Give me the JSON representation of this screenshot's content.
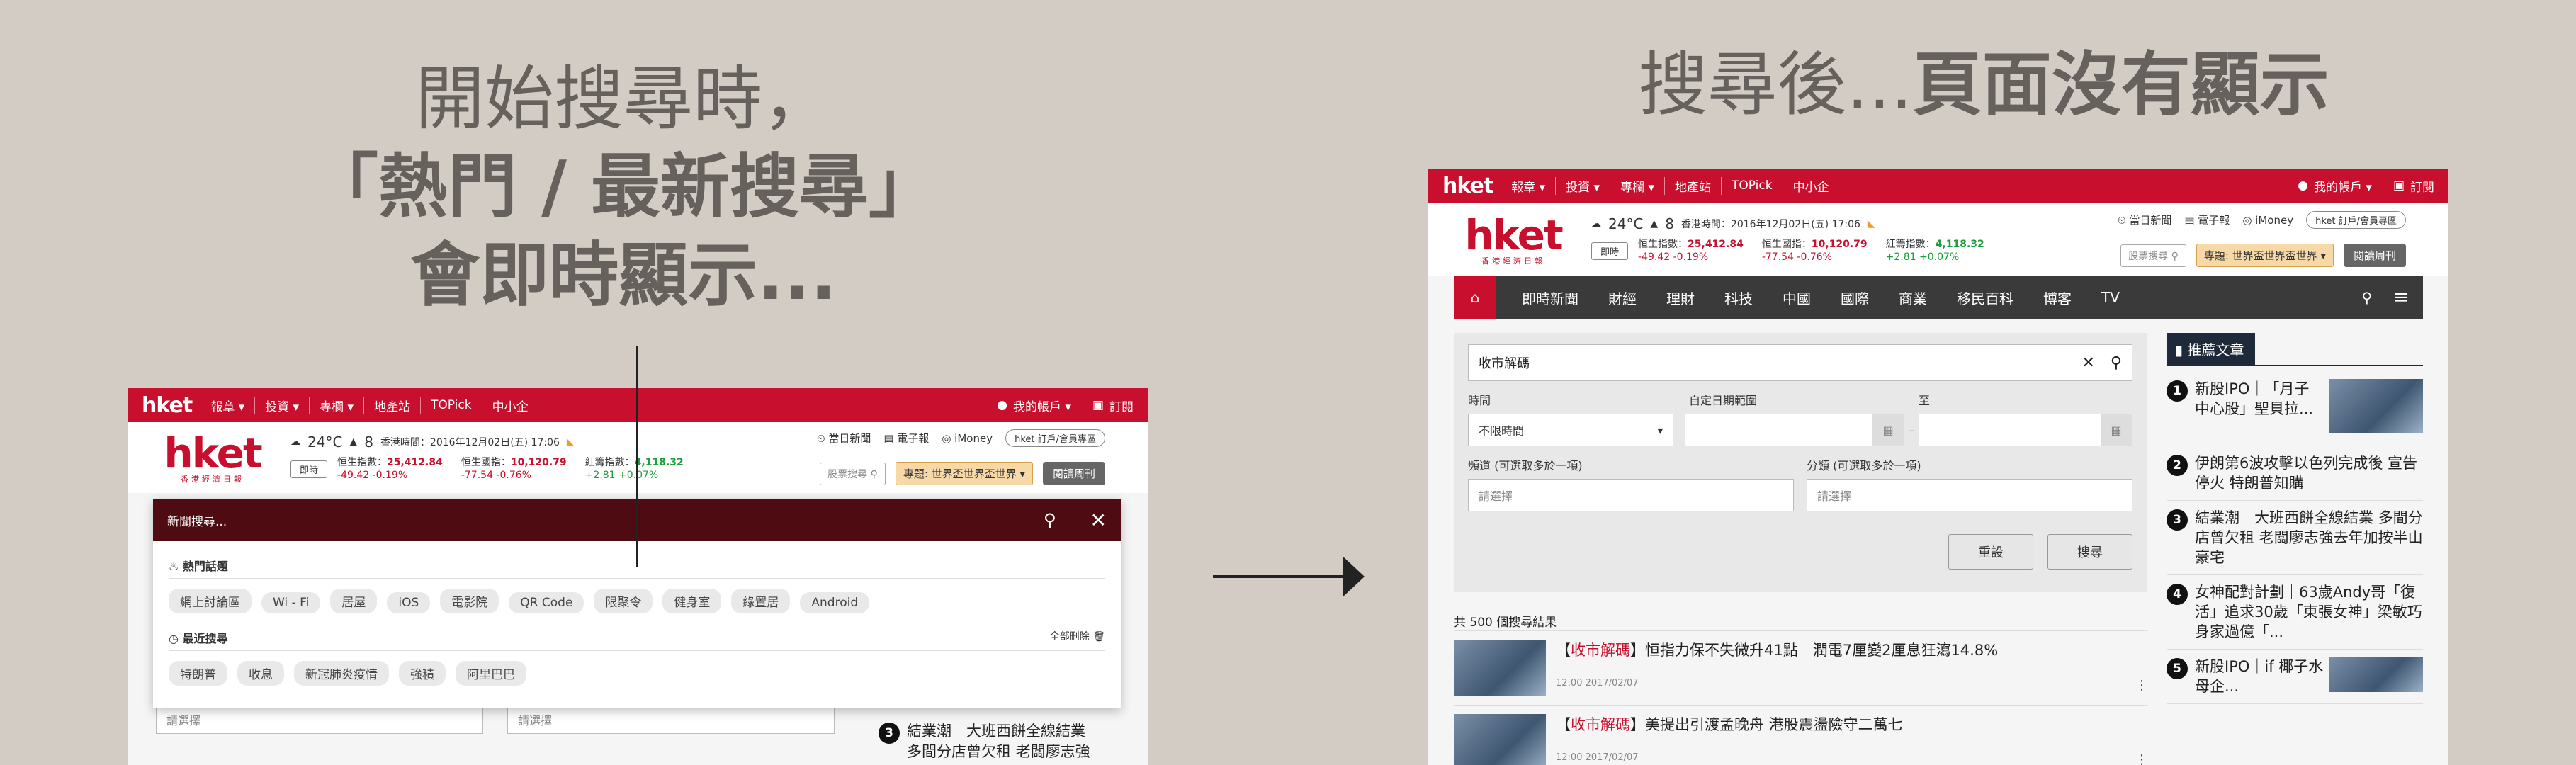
{
  "left_caption": {
    "line1": "開始搜尋時，",
    "line2": "「熱門 / 最新搜尋」",
    "line3": "會即時顯示..."
  },
  "right_caption": {
    "normal": "搜尋後...",
    "bold": "頁面沒有顯示"
  },
  "topnav": {
    "logo": "hket",
    "items": [
      "報章 ▾",
      "投資 ▾",
      "專欄 ▾",
      "地產站",
      "TOPick",
      "中小企"
    ],
    "account": "我的帳戶 ▾",
    "subscribe": "訂閱"
  },
  "header": {
    "logo": "hket",
    "logo_sub": "香港經濟日報",
    "weather_temp": "24°C",
    "weather_uv": "8",
    "time": "香港時間：2016年12月02日(五) 17:06",
    "today_news": "當日新聞",
    "epaper": "電子報",
    "imoney": "iMoney",
    "subscribe_pill": "hket 訂戶/會員專區",
    "instant": "即時",
    "indices": [
      {
        "name": "恒生指數",
        "value": "25,412.84",
        "change": "-49.42 -0.19%",
        "dir": "down"
      },
      {
        "name": "恒生國指",
        "value": "10,120.79",
        "change": "-77.54 -0.76%",
        "dir": "down"
      },
      {
        "name": "紅籌指數",
        "value": "4,118.32",
        "change": "+2.81 +0.07%",
        "dir": "up"
      }
    ],
    "stock_search": "股票搜尋",
    "topic": "專題: 世界盃世界盃世界",
    "weekly": "閱讀周刊"
  },
  "search_overlay": {
    "placeholder": "新聞搜尋...",
    "hot_title": "熱門話題",
    "hot_tags": [
      "網上討論區",
      "Wi - Fi",
      "居屋",
      "iOS",
      "電影院",
      "QR Code",
      "限聚令",
      "健身室",
      "綠置居",
      "Android"
    ],
    "recent_title": "最近搜尋",
    "clear_all": "全部刪除",
    "recent_tags": [
      "特朗普",
      "收息",
      "新冠肺炎疫情",
      "強積",
      "阿里巴巴"
    ]
  },
  "left_below": {
    "select1": "請選擇",
    "select2": "請選擇",
    "news_num": "3",
    "news_line1": "結業潮｜大班西餅全線結業",
    "news_line2": "多間分店曾欠租 老闆廖志強"
  },
  "right_shot": {
    "navbar": [
      "即時新聞",
      "財經",
      "理財",
      "科技",
      "中國",
      "國際",
      "商業",
      "移民百科",
      "博客",
      "TV"
    ],
    "search_value": "收市解碼",
    "labels": {
      "time": "時間",
      "custom_range": "自定日期範圍",
      "to": "至",
      "channel": "頻道 (可選取多於一項)",
      "category": "分類 (可選取多於一項)"
    },
    "time_select": "不限時間",
    "channel_placeholder": "請選擇",
    "category_placeholder": "請選擇",
    "reset": "重設",
    "search": "搜尋",
    "results_count": "共 500 個搜尋結果",
    "results": [
      {
        "keyword": "收市解碼",
        "title": "恒指力保不失微升41點　潤電7厘變2厘息狂瀉14.8%",
        "meta": "12:00 2017/02/07"
      },
      {
        "keyword": "收市解碼",
        "title": "美提出引渡孟晚舟 港股震盪險守二萬七",
        "meta": "12:00 2017/02/07"
      }
    ],
    "sidebar_title": "推薦文章",
    "sidebar_items": [
      {
        "num": "1",
        "text": "新股IPO｜「月子中心股」聖貝拉..."
      },
      {
        "num": "2",
        "text": "伊朗第6波攻擊以色列完成後 宣告停火 特朗普知購"
      },
      {
        "num": "3",
        "text": "結業潮｜大班西餅全線結業 多間分店曾欠租 老闆廖志強去年加按半山豪宅"
      },
      {
        "num": "4",
        "text": "女神配對計劃｜63歲Andy哥「復活」追求30歲「東張女神」梁敏巧　身家過億「..."
      },
      {
        "num": "5",
        "text": "新股IPO｜if 椰子水母企..."
      }
    ]
  }
}
